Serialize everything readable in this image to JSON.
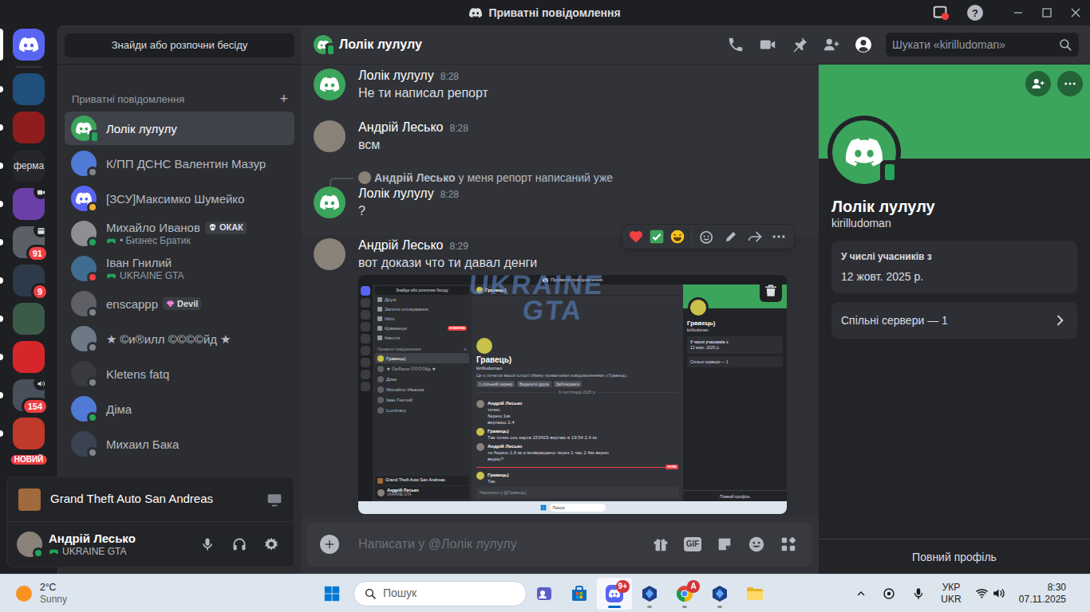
{
  "window": {
    "title": "Приватні повідомлення",
    "help": "?"
  },
  "servers": {
    "home": {
      "selected": true
    },
    "items": [
      {
        "kind": "image",
        "color": "#1f4f7a",
        "unread": true,
        "selected": false
      },
      {
        "kind": "image",
        "color": "#8f1d1d",
        "unread": true,
        "selected": false
      },
      {
        "kind": "text",
        "label": "ферма",
        "color": "#26272b",
        "unread": true,
        "selected": false
      },
      {
        "kind": "image",
        "color": "#6b3fa8",
        "corner": "video",
        "unread": true,
        "selected": false
      },
      {
        "kind": "image",
        "color": "#5b5f66",
        "badge": "91",
        "badge_kind": "count",
        "corner": "calendar",
        "unread": true,
        "selected": false
      },
      {
        "kind": "image",
        "color": "#2d3a4a",
        "badge": "9",
        "badge_kind": "count",
        "unread": true,
        "selected": false
      },
      {
        "kind": "image",
        "color": "#3c5a48",
        "unread": true,
        "selected": false
      },
      {
        "kind": "image",
        "color": "#d6262b",
        "unread": true,
        "selected": false
      },
      {
        "kind": "image",
        "color": "#48505c",
        "badge": "154",
        "badge_kind": "count",
        "corner": "speaker",
        "unread": true,
        "selected": false
      },
      {
        "kind": "image",
        "color": "#c0392b",
        "badge": "НОВИЙ",
        "badge_kind": "new",
        "unread": true,
        "selected": false
      }
    ]
  },
  "dm": {
    "search": "Знайди або розпочни бесіду",
    "heading": "Приватні повідомлення",
    "add": "+",
    "items": [
      {
        "name": "Лолік лулулу",
        "avatar": "default",
        "color": "#3ba55c",
        "status": "mobile",
        "selected": true
      },
      {
        "name": "К/ПП ДСНС Валентин Мазур",
        "avatar": "image",
        "color": "#4f7bd6",
        "status": "offline",
        "selected": false
      },
      {
        "name": "[ЗСУ]Максимко Шумейко",
        "avatar": "default",
        "color": "#5865f2",
        "status": "idle",
        "selected": false
      },
      {
        "name": "Михайло Иванов",
        "tag": "ОКАК",
        "tag_icon": "skull",
        "activity": "• Бизнес Братик",
        "avatar": "image",
        "color": "#8d8f94",
        "status": "online",
        "selected": false
      },
      {
        "name": "Іван Гнилий",
        "activity": "UKRAINE GTA",
        "avatar": "image",
        "color": "#3f6c8f",
        "status": "dnd",
        "selected": false
      },
      {
        "name": "enscappp",
        "tag": "Devil",
        "tag_icon": "gem",
        "avatar": "image",
        "color": "#5e6066",
        "status": "offline",
        "selected": false
      },
      {
        "name": "★ ©и®илл ©©©©йд ★",
        "avatar": "image",
        "color": "#6c7a86",
        "status": "offline",
        "selected": false
      },
      {
        "name": "Kletens fatq",
        "avatar": "image",
        "color": "#3a3b3f",
        "status": "offline",
        "selected": false
      },
      {
        "name": "Діма",
        "avatar": "image",
        "color": "#4f7bd6",
        "status": "online",
        "selected": false
      },
      {
        "name": "Михаил Бака",
        "avatar": "image",
        "color": "#3b4352",
        "status": "offline",
        "selected": false
      }
    ]
  },
  "activity": {
    "game": "Grand Theft Auto San Andreas"
  },
  "user": {
    "name": "Андрій Лесько",
    "activity": "UKRAINE GTA",
    "status": "online",
    "color": "#8a8178"
  },
  "chat": {
    "name": "Лолік лулулу",
    "status": "mobile",
    "search": "Шукати «kirilludoman»",
    "profile_open": true,
    "messages": [
      {
        "author": "Лолік лулулу",
        "time": "8:28",
        "avatar": "default",
        "color": "#3ba55c",
        "lines": [
          "Не ти написал репорт"
        ],
        "hovered": false
      },
      {
        "author": "Андрій Лесько",
        "time": "8:28",
        "avatar": "photo",
        "color": "#8a8178",
        "lines": [
          "всм"
        ],
        "hovered": false
      },
      {
        "author": "Лолік лулулу",
        "time": "8:28",
        "avatar": "default",
        "color": "#3ba55c",
        "reply": {
          "author": "Андрій Лесько",
          "text": "у меня репорт написаний уже"
        },
        "lines": [
          "?"
        ],
        "hovered": false
      },
      {
        "author": "Андрій Лесько",
        "time": "8:29",
        "avatar": "photo",
        "color": "#8a8178",
        "lines": [
          "вот докази что ти давал денги"
        ],
        "attachment": true,
        "hovered": true
      }
    ],
    "input": {
      "placeholder": "Написати у @Лолік лулулу",
      "gif": "GIF"
    }
  },
  "profile": {
    "name": "Лолік лулулу",
    "username": "kirilludoman",
    "status": "mobile",
    "since_label": "У числі учасників з",
    "since": "12 жовт. 2025 р.",
    "mutual": "Спільні сервери — 1",
    "full": "Повний профіль"
  },
  "screenshot": {
    "title": "Приватні повідомлення",
    "search": "Знайди або розпочни бесіду",
    "nav": [
      {
        "label": "Друзі",
        "selected": false
      },
      {
        "label": "Запити спілкування",
        "selected": false
      },
      {
        "label": "Nitro",
        "selected": false
      },
      {
        "label": "Крамниця",
        "badge": "НОВИНКА",
        "selected": false
      },
      {
        "label": "Квести",
        "selected": false
      }
    ],
    "heading": "Приватні повідомлення",
    "add": "+",
    "dms": [
      {
        "name": "Гравець)",
        "selected": true
      },
      {
        "name": "★ ©и®илл ©©©©йд ★",
        "selected": false
      },
      {
        "name": "Діма",
        "selected": false
      },
      {
        "name": "Михайло Иванов",
        "selected": false
      },
      {
        "name": "Іван Гнилий",
        "selected": false
      },
      {
        "name": "Luminary",
        "selected": false
      }
    ],
    "game": "Grand Theft Auto San Andreas",
    "user": "Андрій Лесько",
    "user_activity": "UKRAINE GTA",
    "chat_name": "Гравець)",
    "username": "kirilludoman",
    "intro": "Це є початок вашої історії обміну приватними повідомленнями з Гравець).",
    "actions": [
      "1 спільний сервер",
      "Видалити друга",
      "Заблокувати"
    ],
    "date": "6 листопада 2025 р.",
    "new": "НОВЕ",
    "messages": [
      {
        "author": "Андрій Лесько",
        "color": "#8a8178",
        "lines": [
          "точно",
          "береш 1кк",
          "вертаєш 2.4"
        ],
        "unread_start": false
      },
      {
        "author": "Гравець)",
        "color": "#c9c24a",
        "lines": [
          "Так точно ось карта 153429 вертаю в 19:54 2.4 кк"
        ],
        "unread_start": false
      },
      {
        "author": "Андрій Лесько",
        "color": "#8a8178",
        "lines": [
          "ти береш 1.6 кк и возвращаеш через 1 час 2.4кк верно",
          "верно?"
        ],
        "unread_start": false
      },
      {
        "author": "Гравець)",
        "color": "#c9c24a",
        "lines": [
          "Так"
        ],
        "unread_start": true
      }
    ],
    "input": "Написати у @Гравець)",
    "profile": {
      "name": "Гравець)",
      "username": "kirilludoman",
      "since_label": "У числі учасників з",
      "since": "12 жовт. 2025 р.",
      "mutual": "Спільні сервери — 1",
      "full": "Повний профіль"
    },
    "taskbar_search": "Пошук",
    "watermark": [
      "UKRAINE",
      "GTA"
    ]
  },
  "taskbar": {
    "weather": {
      "temp": "2°C",
      "text": "Sunny"
    },
    "search": "Пошук",
    "apps": [
      {
        "kind": "teams",
        "running": false,
        "selected": false
      },
      {
        "kind": "store",
        "running": false,
        "selected": false
      },
      {
        "kind": "discord",
        "running": true,
        "selected": true,
        "badge": "9+"
      },
      {
        "kind": "mta",
        "running": true,
        "selected": false
      },
      {
        "kind": "chrome",
        "running": true,
        "selected": false,
        "badge": "A"
      },
      {
        "kind": "mta",
        "running": true,
        "selected": false
      },
      {
        "kind": "explorer",
        "running": false,
        "selected": false
      }
    ],
    "tray": {
      "lang": [
        "УКР",
        "UKR"
      ],
      "time": "8:30",
      "date": "07.11.2025"
    }
  }
}
